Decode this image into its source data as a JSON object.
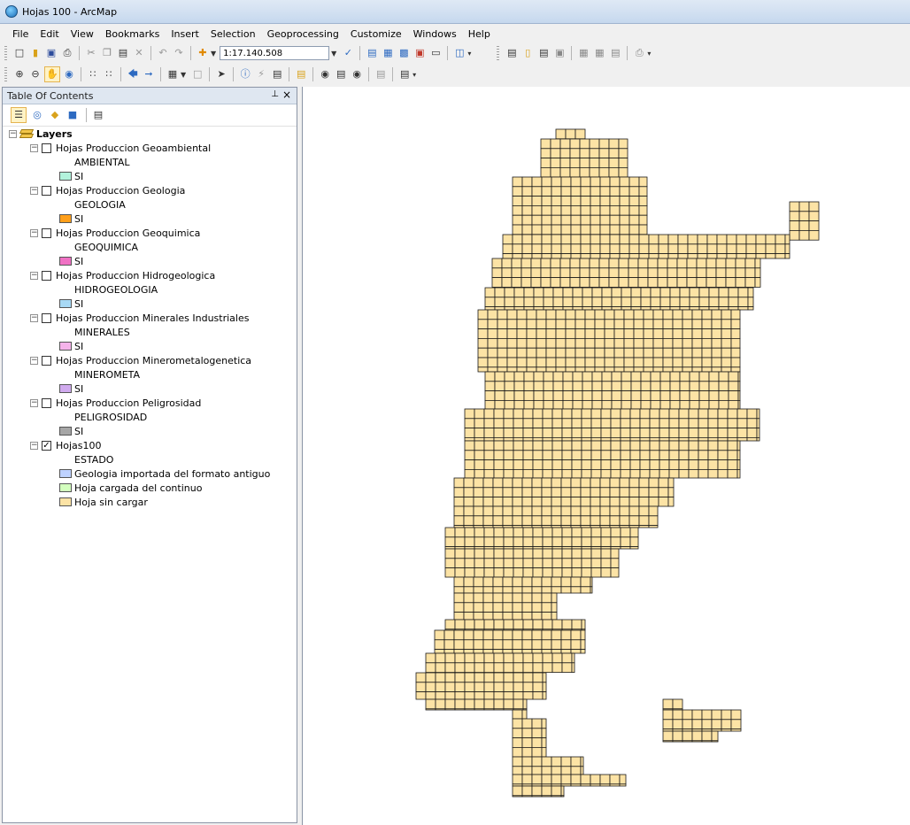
{
  "window": {
    "title": "Hojas 100 - ArcMap"
  },
  "menu": [
    "File",
    "Edit",
    "View",
    "Bookmarks",
    "Insert",
    "Selection",
    "Geoprocessing",
    "Customize",
    "Windows",
    "Help"
  ],
  "toolbar": {
    "scale": "1:17.140.508"
  },
  "toc": {
    "title": "Table Of Contents",
    "root_label": "Layers",
    "groups": [
      {
        "name": "Hojas Produccion Geoambiental",
        "field": "AMBIENTAL",
        "value": "SI",
        "color": "#b3f2dc",
        "checked": false
      },
      {
        "name": "Hojas Produccion Geologia",
        "field": "GEOLOGIA",
        "value": "SI",
        "color": "#ff9f1a",
        "checked": false
      },
      {
        "name": "Hojas Produccion Geoquimica",
        "field": "GEOQUIMICA",
        "value": "SI",
        "color": "#f071c4",
        "checked": false
      },
      {
        "name": "Hojas Produccion Hidrogeologica",
        "field": "HIDROGEOLOGIA",
        "value": "SI",
        "color": "#a7d9f5",
        "checked": false
      },
      {
        "name": "Hojas Produccion Minerales Industriales",
        "field": "MINERALES",
        "value": "SI",
        "color": "#f5b3ea",
        "checked": false
      },
      {
        "name": "Hojas Produccion Minerometalogenetica",
        "field": "MINEROMETA",
        "value": "SI",
        "color": "#d0aaee",
        "checked": false
      },
      {
        "name": "Hojas Produccion Peligrosidad",
        "field": "PELIGROSIDAD",
        "value": "SI",
        "color": "#a6a6a6",
        "checked": false
      }
    ],
    "hojas": {
      "name": "Hojas100",
      "field": "ESTADO",
      "checked": true,
      "classes": [
        {
          "label": "Geologia importada del formato antiguo",
          "color": "#bed2ff"
        },
        {
          "label": "Hoja cargada del continuo",
          "color": "#d3ffbe"
        },
        {
          "label": "Hoja sin cargar",
          "color": "#fce3a5"
        }
      ]
    }
  },
  "map": {
    "fill": "#fce3a5",
    "stroke": "#1a1a1a",
    "background": "#ffffff"
  }
}
